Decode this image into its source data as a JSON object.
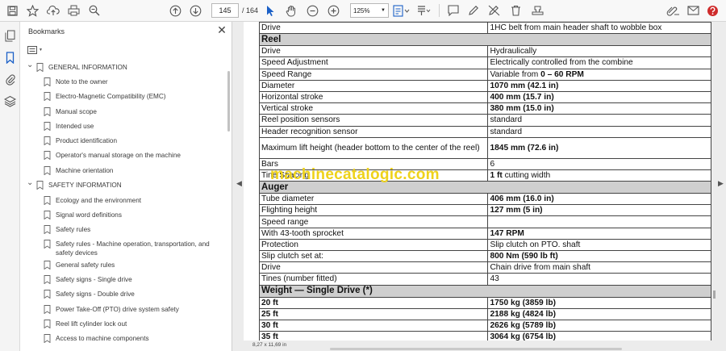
{
  "toolbar": {
    "page_current": "145",
    "page_total": "/  164",
    "zoom": "125%"
  },
  "bookmarks": {
    "title": "Bookmarks",
    "close_glyph": "✕",
    "items": [
      {
        "label": "GENERAL INFORMATION",
        "level": 0,
        "expanded": true
      },
      {
        "label": "Note to the owner",
        "level": 1
      },
      {
        "label": "Electro-Magnetic Compatibility (EMC)",
        "level": 1
      },
      {
        "label": "Manual scope",
        "level": 1
      },
      {
        "label": "Intended use",
        "level": 1
      },
      {
        "label": "Product identification",
        "level": 1
      },
      {
        "label": "Operator's manual storage on the machine",
        "level": 1
      },
      {
        "label": "Machine orientation",
        "level": 1
      },
      {
        "label": "SAFETY INFORMATION",
        "level": 0,
        "expanded": true
      },
      {
        "label": "Ecology and the environment",
        "level": 1
      },
      {
        "label": "Signal word definitions",
        "level": 1
      },
      {
        "label": "Safety rules",
        "level": 1
      },
      {
        "label": "Safety rules - Machine operation, transportation, and safety devices",
        "level": 1
      },
      {
        "label": "General safety rules",
        "level": 1
      },
      {
        "label": "Safety signs - Single drive",
        "level": 1
      },
      {
        "label": "Safety signs - Double drive",
        "level": 1
      },
      {
        "label": "Power Take-Off (PTO) drive system safety",
        "level": 1
      },
      {
        "label": "Reel lift cylinder lock out",
        "level": 1
      },
      {
        "label": "Access to machine components",
        "level": 1
      }
    ]
  },
  "document": {
    "rows": [
      {
        "type": "row",
        "label": "Drive",
        "value": "1HC belt from main header shaft to wobble box"
      },
      {
        "type": "section",
        "label": "Reel"
      },
      {
        "type": "row",
        "label": "Drive",
        "value": "Hydraulically"
      },
      {
        "type": "row",
        "label": "Speed Adjustment",
        "value": "Electrically controlled from the combine"
      },
      {
        "type": "row",
        "label": "Speed Range",
        "value": "Variable from ",
        "bold": "0 – 60 RPM"
      },
      {
        "type": "row",
        "label": "Diameter",
        "bold": "1070 mm (42.1 in)"
      },
      {
        "type": "row",
        "label": "Horizontal stroke",
        "bold": "400 mm (15.7 in)"
      },
      {
        "type": "row",
        "label": "Vertical stroke",
        "bold": "380 mm (15.0 in)"
      },
      {
        "type": "row",
        "label": "Reel position sensors",
        "value": "standard"
      },
      {
        "type": "row",
        "label": "Header recognition sensor",
        "value": "standard"
      },
      {
        "type": "tall",
        "label": "Maximum lift height (header bottom to the center of the reel)",
        "bold": "1845 mm (72.6 in)"
      },
      {
        "type": "row",
        "label": "Bars",
        "value": "6"
      },
      {
        "type": "row",
        "label": "Tine Spacing",
        "bold": "1 ft",
        "value_after": " cutting width"
      },
      {
        "type": "section",
        "label": "Auger"
      },
      {
        "type": "row",
        "label": "Tube diameter",
        "bold": "406 mm (16.0 in)"
      },
      {
        "type": "row",
        "label": "Flighting height",
        "bold": "127 mm (5 in)"
      },
      {
        "type": "row",
        "label": "Speed range",
        "value": ""
      },
      {
        "type": "row",
        "label": "With 43-tooth sprocket",
        "bold": "147 RPM"
      },
      {
        "type": "row",
        "label": "Protection",
        "value": "Slip clutch on PTO. shaft"
      },
      {
        "type": "row",
        "label": "Slip clutch set at:",
        "bold": "800 Nm (590 lb ft)"
      },
      {
        "type": "row",
        "label": "Drive",
        "value": "Chain drive from main shaft"
      },
      {
        "type": "row",
        "label": "Tines (number fitted)",
        "value": "43"
      },
      {
        "type": "section",
        "label": "Weight — Single Drive (*)"
      },
      {
        "type": "row",
        "label": "20 ft",
        "label_bold": true,
        "bold": "1750 kg (3859 lb)"
      },
      {
        "type": "row",
        "label": "25 ft",
        "label_bold": true,
        "bold": "2188 kg (4824 lb)"
      },
      {
        "type": "row",
        "label": "30 ft",
        "label_bold": true,
        "bold": "2626 kg (5789 lb)"
      },
      {
        "type": "row",
        "label": "35 ft",
        "label_bold": true,
        "bold": "3064 kg (6754 lb)"
      }
    ],
    "watermark": "machinecatalogic.com",
    "page_size": "8,27 x 11,69 in"
  },
  "nav": {
    "prev": "◀",
    "next": "▶"
  }
}
